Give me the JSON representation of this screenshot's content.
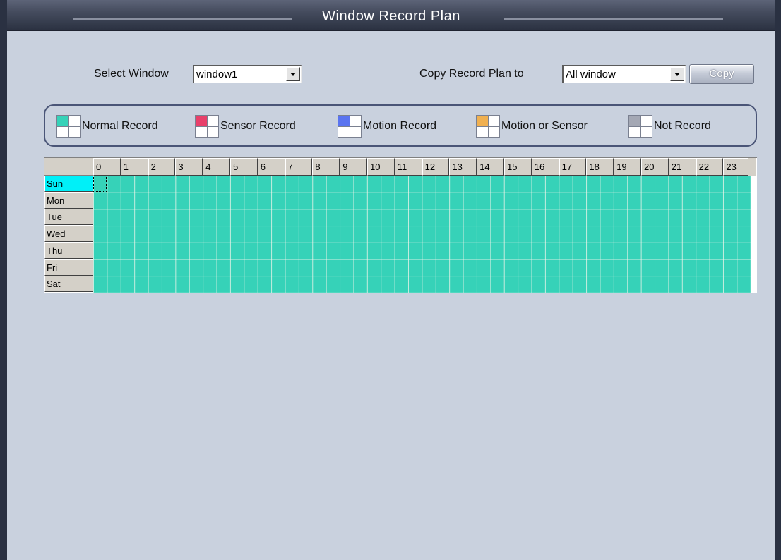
{
  "window": {
    "title": "Window Record Plan"
  },
  "controls": {
    "select_window_label": "Select Window",
    "select_window_value": "window1",
    "copy_plan_label": "Copy Record Plan to",
    "copy_plan_value": "All window",
    "copy_button_label": "Copy"
  },
  "legend": [
    {
      "label": "Normal Record",
      "color": "#36d2b8"
    },
    {
      "label": "Sensor Record",
      "color": "#e8406a"
    },
    {
      "label": "Motion Record",
      "color": "#5a74f0"
    },
    {
      "label": "Motion or Sensor",
      "color": "#f0b050"
    },
    {
      "label": "Not Record",
      "color": "#a4a8b4"
    }
  ],
  "schedule": {
    "hours": [
      "0",
      "1",
      "2",
      "3",
      "4",
      "5",
      "6",
      "7",
      "8",
      "9",
      "10",
      "11",
      "12",
      "13",
      "14",
      "15",
      "16",
      "17",
      "18",
      "19",
      "20",
      "21",
      "22",
      "23"
    ],
    "days": [
      "Sun",
      "Mon",
      "Tue",
      "Wed",
      "Thu",
      "Fri",
      "Sat"
    ],
    "selected_day": "Sun",
    "all_cells_mode": "Normal Record",
    "cell_color": "#36d2b8"
  }
}
